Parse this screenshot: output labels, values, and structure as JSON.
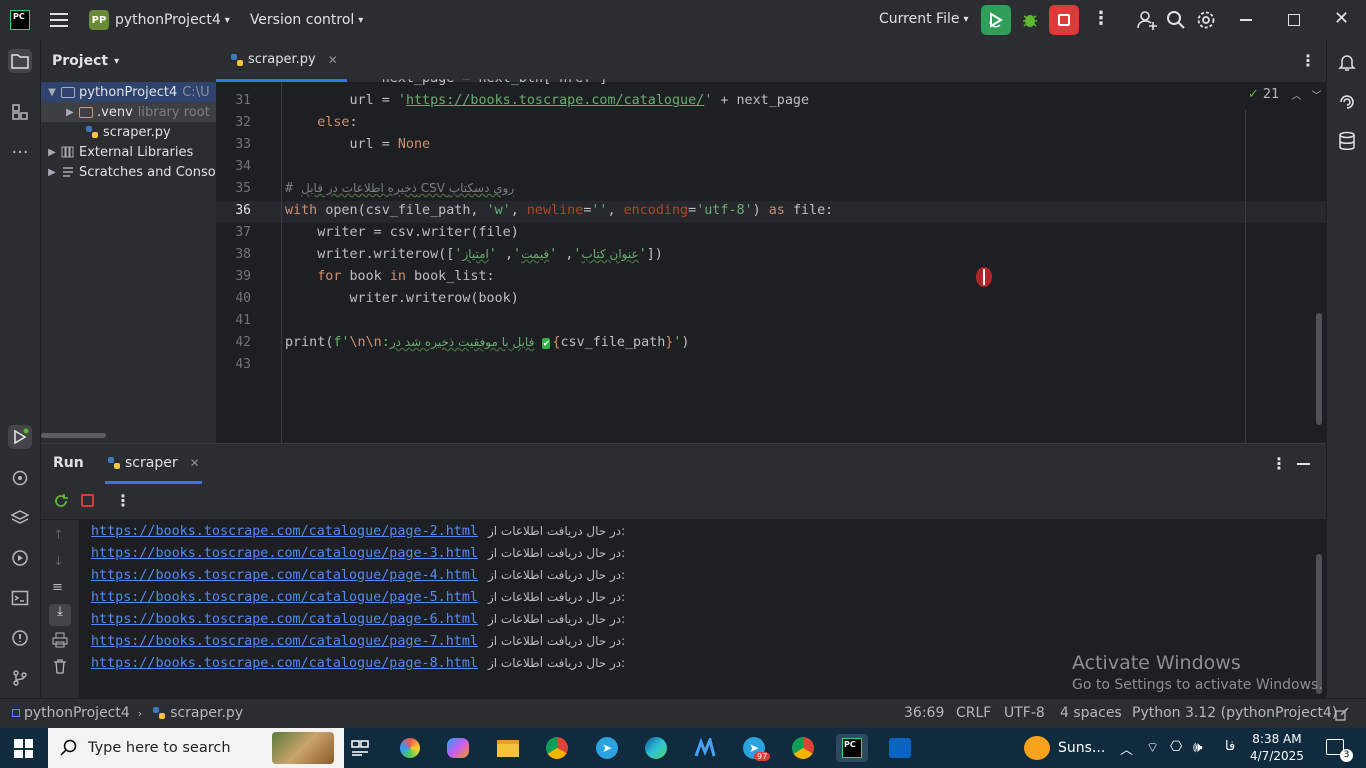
{
  "titlebar": {
    "app_badge": "PC",
    "project_badge": "PP",
    "project_name": "pythonProject4",
    "vcs_label": "Version control",
    "run_config": "Current File"
  },
  "project_panel": {
    "title": "Project",
    "tree": [
      {
        "label": "pythonProject4",
        "suffix": "C:\\U",
        "kind": "folder",
        "expanded": true,
        "selected": true
      },
      {
        "label": ".venv",
        "suffix": "library root",
        "kind": "folder",
        "expanded": false
      },
      {
        "label": "scraper.py",
        "suffix": "",
        "kind": "python"
      },
      {
        "label": "External Libraries",
        "suffix": "",
        "kind": "library"
      },
      {
        "label": "Scratches and Conso",
        "suffix": "",
        "kind": "scratch"
      }
    ]
  },
  "editor": {
    "tab_label": "scraper.py",
    "inspection_count": "21",
    "current_line": "36",
    "lines": [
      {
        "n": "",
        "tokens": [
          [
            "            ",
            ""
          ],
          [
            "next_page = next_btn['href']",
            "dim"
          ]
        ]
      },
      {
        "n": "31",
        "tokens": [
          [
            "        url = ",
            ""
          ],
          [
            "'",
            "str"
          ],
          [
            "https://books.toscrape.com/catalogue/",
            "url"
          ],
          [
            "'",
            "str"
          ],
          [
            " + next_page",
            ""
          ]
        ]
      },
      {
        "n": "32",
        "tokens": [
          [
            "    ",
            ""
          ],
          [
            "else",
            "kw"
          ],
          [
            ":",
            ""
          ]
        ]
      },
      {
        "n": "33",
        "tokens": [
          [
            "        url = ",
            ""
          ],
          [
            "None",
            "kw"
          ]
        ]
      },
      {
        "n": "34",
        "tokens": []
      },
      {
        "n": "35",
        "tokens": [
          [
            "# ",
            "cm"
          ],
          [
            "ذخیره اطلاعات در فایل CSV روی دسکتاپ",
            "cmfa"
          ]
        ]
      },
      {
        "n": "36",
        "tokens": [
          [
            "with ",
            "kw"
          ],
          [
            "open",
            ""
          ],
          [
            "(csv_file_path, ",
            ""
          ],
          [
            "'w'",
            "str"
          ],
          [
            ", ",
            ""
          ],
          [
            "newline",
            "param"
          ],
          [
            "=",
            ""
          ],
          [
            "''",
            "str"
          ],
          [
            ", ",
            ""
          ],
          [
            "encoding",
            "param"
          ],
          [
            "=",
            ""
          ],
          [
            "'utf-8'",
            "str"
          ],
          [
            ") ",
            ""
          ],
          [
            "as ",
            "kw"
          ],
          [
            "file:",
            ""
          ]
        ]
      },
      {
        "n": "37",
        "tokens": [
          [
            "    writer = csv.writer(file)",
            ""
          ]
        ]
      },
      {
        "n": "38",
        "tokens": [
          [
            "    writer.writerow([",
            ""
          ],
          [
            "'",
            "str"
          ],
          [
            "عنوان کتاب",
            "strfa"
          ],
          [
            "'",
            "str"
          ],
          [
            ", ",
            ""
          ],
          [
            "'",
            "str"
          ],
          [
            "قیمت",
            "strfa"
          ],
          [
            "'",
            "str"
          ],
          [
            ", ",
            ""
          ],
          [
            "'",
            "str"
          ],
          [
            "امتیاز",
            "strfa"
          ],
          [
            "'",
            "str"
          ],
          [
            "])",
            ""
          ]
        ]
      },
      {
        "n": "39",
        "tokens": [
          [
            "    ",
            ""
          ],
          [
            "for ",
            "kw"
          ],
          [
            "book ",
            ""
          ],
          [
            "in ",
            "kw"
          ],
          [
            "book_list:",
            ""
          ]
        ]
      },
      {
        "n": "40",
        "tokens": [
          [
            "        writer.writerow(book)",
            ""
          ]
        ]
      },
      {
        "n": "41",
        "tokens": []
      },
      {
        "n": "42",
        "tokens": [
          [
            "print",
            ""
          ],
          [
            "(",
            ""
          ],
          [
            "f'",
            "str"
          ],
          [
            "\\n",
            "esc"
          ],
          [
            "\\n",
            "esc"
          ],
          [
            ":",
            "str"
          ],
          [
            "فایل با موفقیت ذخیره شد در",
            "strfa"
          ],
          [
            " ",
            ""
          ],
          [
            "✅",
            "emoji"
          ],
          [
            "{",
            "esc"
          ],
          [
            "csv_file_path",
            ""
          ],
          [
            "}",
            "esc"
          ],
          [
            "'",
            "str"
          ],
          [
            ")",
            ""
          ]
        ]
      },
      {
        "n": "43",
        "tokens": []
      }
    ]
  },
  "run_panel": {
    "title": "Run",
    "tab_label": "scraper",
    "output_prefix": "در حال دریافت اطلاعات از:",
    "output_urls": [
      "https://books.toscrape.com/catalogue/page-2.html",
      "https://books.toscrape.com/catalogue/page-3.html",
      "https://books.toscrape.com/catalogue/page-4.html",
      "https://books.toscrape.com/catalogue/page-5.html",
      "https://books.toscrape.com/catalogue/page-6.html",
      "https://books.toscrape.com/catalogue/page-7.html",
      "https://books.toscrape.com/catalogue/page-8.html"
    ]
  },
  "watermark": {
    "title": "Activate Windows",
    "subtitle": "Go to Settings to activate Windows."
  },
  "statusbar": {
    "project": "pythonProject4",
    "file": "scraper.py",
    "position": "36:69",
    "line_sep": "CRLF",
    "encoding": "UTF-8",
    "indent": "4 spaces",
    "interpreter": "Python 3.12 (pythonProject4)"
  },
  "taskbar": {
    "search_placeholder": "Type here to search",
    "weather": "Suns...",
    "lang": "فا",
    "time": "8:38 AM",
    "date": "4/7/2025",
    "notif_count": "3",
    "telegram_badge": "97"
  },
  "colors": {
    "accent": "#3574f0",
    "run_green": "#2f9e59",
    "stop_red": "#dd3a3a",
    "keyword": "#cf8e6d",
    "string": "#6aab73",
    "link": "#548af7"
  }
}
